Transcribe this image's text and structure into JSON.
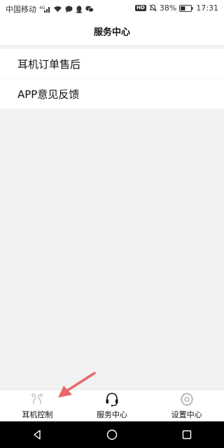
{
  "status_bar": {
    "carrier": "中国移动",
    "signal_type": "⁴ᴳ",
    "hd_label": "HD",
    "battery": "38%",
    "time": "17:31",
    "icons": [
      "signal-icon",
      "wifi-icon",
      "message-icon",
      "qq-icon",
      "wechat-icon",
      "mute-icon",
      "battery-icon"
    ]
  },
  "header": {
    "title": "服务中心"
  },
  "menu": {
    "items": [
      {
        "label": "耳机订单售后"
      },
      {
        "label": "APP意见反馈"
      }
    ]
  },
  "tab_bar": {
    "tabs": [
      {
        "label": "耳机控制",
        "icon": "earbuds-icon"
      },
      {
        "label": "服务中心",
        "icon": "headset-icon",
        "active": true
      },
      {
        "label": "设置中心",
        "icon": "gear-icon"
      }
    ]
  },
  "nav_bar": {
    "buttons": [
      "back-icon",
      "home-icon",
      "recents-icon"
    ]
  },
  "colors": {
    "background": "#f2f2f2",
    "surface": "#ffffff",
    "annotation_arrow": "#e8676a",
    "inactive_icon": "#bbbbbb"
  }
}
